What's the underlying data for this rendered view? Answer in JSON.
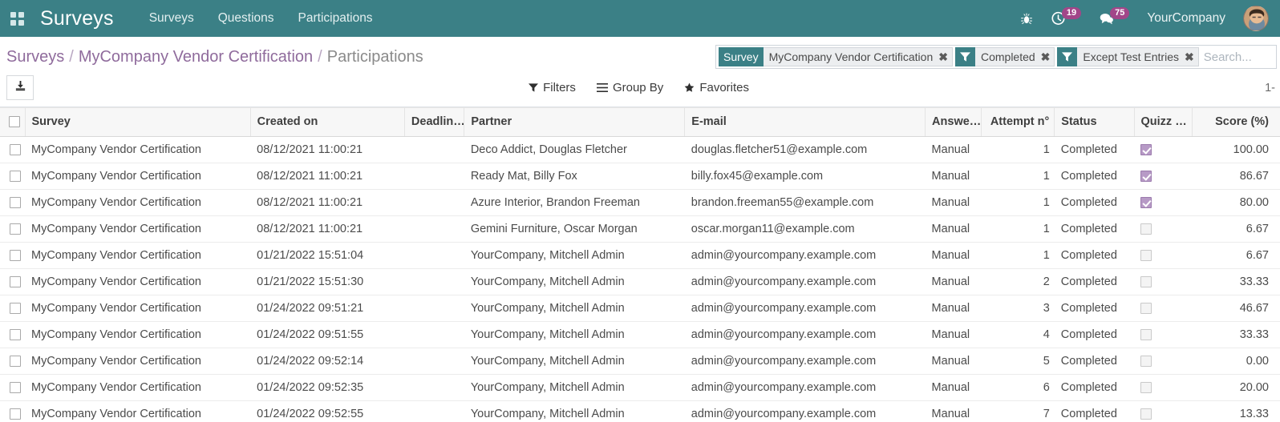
{
  "navbar": {
    "apps_icon": "apps-grid-icon",
    "brand": "Surveys",
    "menus": [
      {
        "label": "Surveys"
      },
      {
        "label": "Questions"
      },
      {
        "label": "Participations"
      }
    ],
    "debug_icon": "bug-icon",
    "activities": {
      "icon": "clock-icon",
      "count": "19"
    },
    "messages": {
      "icon": "chat-icon",
      "count": "75"
    },
    "company": "YourCompany",
    "avatar": "user-avatar"
  },
  "breadcrumb": {
    "root": "Surveys",
    "sep1": "/",
    "record": "MyCompany Vendor Certification",
    "sep2": "/",
    "current": "Participations"
  },
  "search": {
    "placeholder": "Search...",
    "facets": [
      {
        "title": "Survey",
        "icon": null,
        "value": "MyCompany Vendor Certification",
        "remove": "✖"
      },
      {
        "title": null,
        "icon": "filter-icon",
        "value": "Completed",
        "remove": "✖"
      },
      {
        "title": null,
        "icon": "filter-icon",
        "value": "Except Test Entries",
        "remove": "✖"
      }
    ]
  },
  "toolbar": {
    "export_icon": "download-icon",
    "filters_label": "Filters",
    "filters_icon": "filter-icon",
    "groupby_label": "Group By",
    "groupby_icon": "list-icon",
    "favorites_label": "Favorites",
    "favorites_icon": "star-icon",
    "pager": "1-"
  },
  "table": {
    "columns": [
      {
        "key": "select_all",
        "label": ""
      },
      {
        "key": "survey",
        "label": "Survey"
      },
      {
        "key": "created_on",
        "label": "Created on"
      },
      {
        "key": "deadline",
        "label": "Deadlin…"
      },
      {
        "key": "partner",
        "label": "Partner"
      },
      {
        "key": "email",
        "label": "E-mail"
      },
      {
        "key": "answered",
        "label": "Answe…"
      },
      {
        "key": "attempt",
        "label": "Attempt n°"
      },
      {
        "key": "status",
        "label": "Status"
      },
      {
        "key": "quizz",
        "label": "Quizz …"
      },
      {
        "key": "score",
        "label": "Score (%)"
      }
    ],
    "rows": [
      {
        "survey": "MyCompany Vendor Certification",
        "created_on": "08/12/2021 11:00:21",
        "deadline": "",
        "partner": "Deco Addict, Douglas Fletcher",
        "email": "douglas.fletcher51@example.com",
        "answered": "Manual",
        "attempt": "1",
        "status": "Completed",
        "quizz": true,
        "score": "100.00"
      },
      {
        "survey": "MyCompany Vendor Certification",
        "created_on": "08/12/2021 11:00:21",
        "deadline": "",
        "partner": "Ready Mat, Billy Fox",
        "email": "billy.fox45@example.com",
        "answered": "Manual",
        "attempt": "1",
        "status": "Completed",
        "quizz": true,
        "score": "86.67"
      },
      {
        "survey": "MyCompany Vendor Certification",
        "created_on": "08/12/2021 11:00:21",
        "deadline": "",
        "partner": "Azure Interior, Brandon Freeman",
        "email": "brandon.freeman55@example.com",
        "answered": "Manual",
        "attempt": "1",
        "status": "Completed",
        "quizz": true,
        "score": "80.00"
      },
      {
        "survey": "MyCompany Vendor Certification",
        "created_on": "08/12/2021 11:00:21",
        "deadline": "",
        "partner": "Gemini Furniture, Oscar Morgan",
        "email": "oscar.morgan11@example.com",
        "answered": "Manual",
        "attempt": "1",
        "status": "Completed",
        "quizz": false,
        "score": "6.67"
      },
      {
        "survey": "MyCompany Vendor Certification",
        "created_on": "01/21/2022 15:51:04",
        "deadline": "",
        "partner": "YourCompany, Mitchell Admin",
        "email": "admin@yourcompany.example.com",
        "answered": "Manual",
        "attempt": "1",
        "status": "Completed",
        "quizz": false,
        "score": "6.67"
      },
      {
        "survey": "MyCompany Vendor Certification",
        "created_on": "01/21/2022 15:51:30",
        "deadline": "",
        "partner": "YourCompany, Mitchell Admin",
        "email": "admin@yourcompany.example.com",
        "answered": "Manual",
        "attempt": "2",
        "status": "Completed",
        "quizz": false,
        "score": "33.33"
      },
      {
        "survey": "MyCompany Vendor Certification",
        "created_on": "01/24/2022 09:51:21",
        "deadline": "",
        "partner": "YourCompany, Mitchell Admin",
        "email": "admin@yourcompany.example.com",
        "answered": "Manual",
        "attempt": "3",
        "status": "Completed",
        "quizz": false,
        "score": "46.67"
      },
      {
        "survey": "MyCompany Vendor Certification",
        "created_on": "01/24/2022 09:51:55",
        "deadline": "",
        "partner": "YourCompany, Mitchell Admin",
        "email": "admin@yourcompany.example.com",
        "answered": "Manual",
        "attempt": "4",
        "status": "Completed",
        "quizz": false,
        "score": "33.33"
      },
      {
        "survey": "MyCompany Vendor Certification",
        "created_on": "01/24/2022 09:52:14",
        "deadline": "",
        "partner": "YourCompany, Mitchell Admin",
        "email": "admin@yourcompany.example.com",
        "answered": "Manual",
        "attempt": "5",
        "status": "Completed",
        "quizz": false,
        "score": "0.00"
      },
      {
        "survey": "MyCompany Vendor Certification",
        "created_on": "01/24/2022 09:52:35",
        "deadline": "",
        "partner": "YourCompany, Mitchell Admin",
        "email": "admin@yourcompany.example.com",
        "answered": "Manual",
        "attempt": "6",
        "status": "Completed",
        "quizz": false,
        "score": "20.00"
      },
      {
        "survey": "MyCompany Vendor Certification",
        "created_on": "01/24/2022 09:52:55",
        "deadline": "",
        "partner": "YourCompany, Mitchell Admin",
        "email": "admin@yourcompany.example.com",
        "answered": "Manual",
        "attempt": "7",
        "status": "Completed",
        "quizz": false,
        "score": "13.33"
      }
    ]
  },
  "colors": {
    "navbar_teal": "#3b8086",
    "badge_purple": "#a24689",
    "breadcrumb_link": "#8f6b9c",
    "checkbox_checked": "#b79ac6"
  }
}
